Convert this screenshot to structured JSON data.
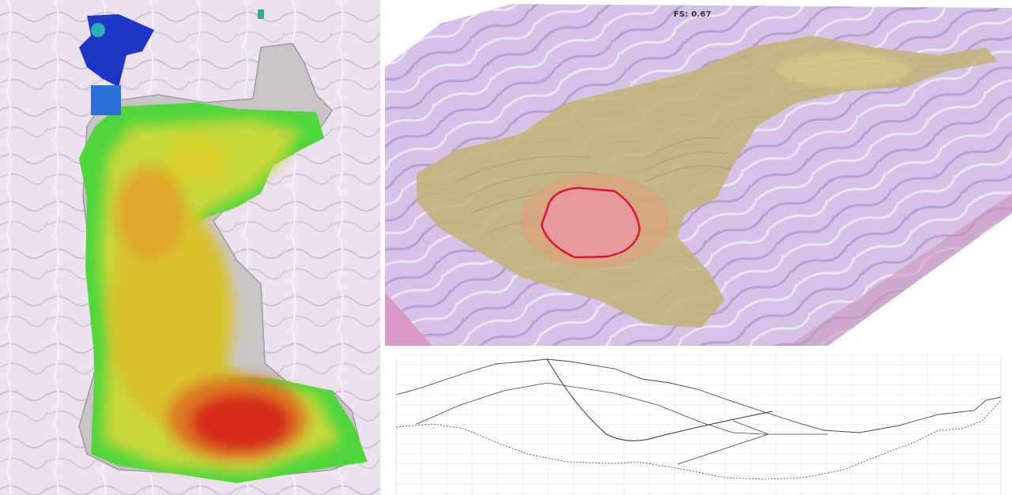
{
  "title": "FS: 0.67",
  "colors": {
    "terrain": "#d9c4e6",
    "terrain_light": "#eadcf0",
    "landslide_fill": "#c2b57a",
    "critical_outline": "#e0123c",
    "critical_fill": "#e69a9a",
    "heat_red": "#d62a1a",
    "heat_green": "#3cd23c",
    "heat_yellow": "#d8d22a",
    "heat_blue": "#1e35c8"
  },
  "icons": [
    "heatmap-image",
    "terrain-3d-image",
    "cross-section-chart"
  ]
}
